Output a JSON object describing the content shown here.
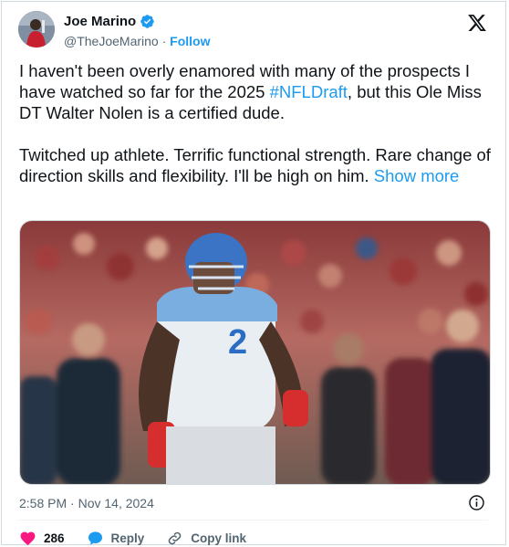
{
  "author": {
    "display_name": "Joe Marino",
    "handle": "@TheJoeMarino",
    "separator": "·",
    "follow_label": "Follow"
  },
  "tweet": {
    "para1_before": "I haven't been overly enamored with many of the prospects I have watched so far for the 2025 ",
    "hashtag": "#NFLDraft",
    "para1_after": ", but this Ole Miss DT Walter Nolen is a certified dude.",
    "para2": "Twitched up athlete. Terrific functional strength. Rare change of direction skills and flexibility. I'll be high on him. ",
    "show_more": "Show more"
  },
  "media": {
    "jersey_number": "2"
  },
  "timestamp": "2:58 PM · Nov 14, 2024",
  "actions": {
    "likes_count": "286",
    "reply_label": "Reply",
    "copy_link_label": "Copy link"
  },
  "colors": {
    "accent": "#1d9bf0",
    "like": "#f91880",
    "text": "#0f1419",
    "muted": "#536471"
  }
}
